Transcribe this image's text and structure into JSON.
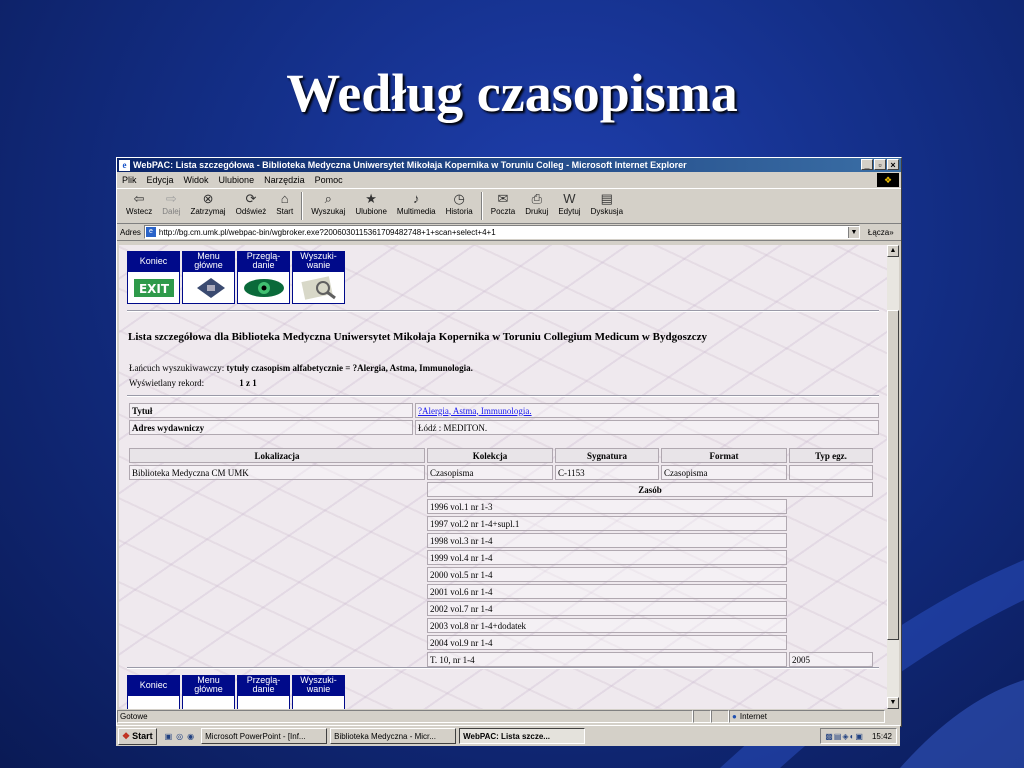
{
  "slide": {
    "title": "Według czasopisma"
  },
  "window": {
    "title": "WebPAC: Lista szczegółowa - Biblioteka Medyczna Uniwersytet Mikołaja Kopernika w Toruniu Colleg - Microsoft Internet Explorer",
    "controls": {
      "minimize": "_",
      "maximize": "▫",
      "close": "×"
    }
  },
  "menu": [
    "Plik",
    "Edycja",
    "Widok",
    "Ulubione",
    "Narzędzia",
    "Pomoc"
  ],
  "toolbar": [
    {
      "label": "Wstecz",
      "icon": "back-arrow-icon",
      "glyph": "⇦"
    },
    {
      "label": "Dalej",
      "icon": "forward-arrow-icon",
      "glyph": "⇨"
    },
    {
      "label": "Zatrzymaj",
      "icon": "stop-icon",
      "glyph": "⊗"
    },
    {
      "label": "Odśwież",
      "icon": "refresh-icon",
      "glyph": "⟳"
    },
    {
      "label": "Start",
      "icon": "home-icon",
      "glyph": "⌂"
    },
    {
      "label": "Wyszukaj",
      "icon": "search-icon",
      "glyph": "⌕"
    },
    {
      "label": "Ulubione",
      "icon": "favorites-icon",
      "glyph": "★"
    },
    {
      "label": "Multimedia",
      "icon": "multimedia-icon",
      "glyph": "♪"
    },
    {
      "label": "Historia",
      "icon": "history-icon",
      "glyph": "◷"
    },
    {
      "label": "Poczta",
      "icon": "mail-icon",
      "glyph": "✉"
    },
    {
      "label": "Drukuj",
      "icon": "print-icon",
      "glyph": "⎙"
    },
    {
      "label": "Edytuj",
      "icon": "edit-icon",
      "glyph": "W"
    },
    {
      "label": "Dyskusja",
      "icon": "discuss-icon",
      "glyph": "▤"
    }
  ],
  "address": {
    "label": "Adres",
    "url": "http://bg.cm.umk.pl/webpac-bin/wgbroker.exe?20060301153617094827​48+1+scan+select+4+1",
    "links_label": "Łącza",
    "links_more": "»"
  },
  "nav_buttons": [
    {
      "label": "Koniec",
      "icon": "exit-icon"
    },
    {
      "label": "Menu\ngłówne",
      "icon": "menu-icon"
    },
    {
      "label": "Przeglą-\ndanie",
      "icon": "eye-icon"
    },
    {
      "label": "Wyszuki-\nwanie",
      "icon": "search-magnifier-icon"
    }
  ],
  "content": {
    "heading": "Lista szczegółowa dla Biblioteka Medyczna Uniwersytet Mikołaja Kopernika w Toruniu Collegium Medicum w Bydgoszczy",
    "chain_label": "Łańcuch wyszukiwawczy:",
    "chain_value": "tytuły czasopism alfabetycznie = ?Alergia, Astma, Immunologia.",
    "record_label": "Wyświetlany rekord:",
    "record_value": "1 z 1",
    "details": [
      {
        "key": "Tytuł",
        "value": "?Alergia, Astma, Immunologia.",
        "link": true
      },
      {
        "key": "Adres wydawniczy",
        "value": "Łódź : MEDITON.",
        "link": false
      }
    ],
    "holdings_headers": [
      "Lokalizacja",
      "Kolekcja",
      "Sygnatura",
      "Format",
      "Typ egz."
    ],
    "holdings_row": [
      "Biblioteka Medyczna CM UMK",
      "Czasopisma",
      "C-1153",
      "Czasopisma",
      ""
    ],
    "zasob_label": "Zasób",
    "zasob": [
      "1996 vol.1 nr 1-3",
      "1997 vol.2 nr 1-4+supl.1",
      "1998 vol.3 nr 1-4",
      "1999 vol.4 nr 1-4",
      "2000 vol.5 nr 1-4",
      "2001 vol.6 nr 1-4",
      "2002 vol.7 nr 1-4",
      "2003 vol.8 nr 1-4+dodatek",
      "2004 vol.9 nr 1-4",
      "T. 10, nr 1-4"
    ],
    "last_year": "2005"
  },
  "statusbar": {
    "text": "Gotowe",
    "zone": "Internet"
  },
  "taskbar": {
    "start": "Start",
    "tasks": [
      "Microsoft PowerPoint - [Inf...",
      "Biblioteka Medyczna - Micr...",
      "WebPAC: Lista szcze..."
    ],
    "clock": "15:42"
  }
}
